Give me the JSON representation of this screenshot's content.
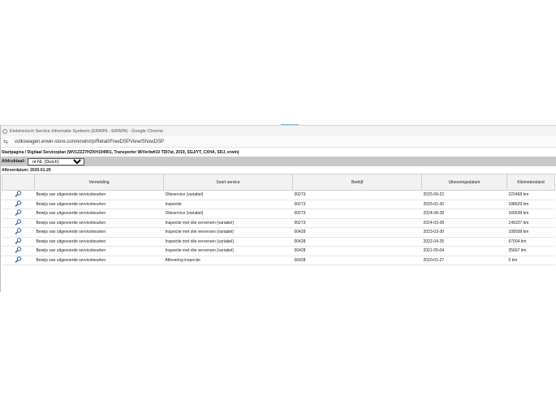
{
  "browser": {
    "title": "Elektronisch Service Informatie Systeem (ERWIN - ERWIN) - Google Chrome",
    "url": "volkswagen.erwin-store.com/erwin/rp/Retail/FreeDSPView/ShowDSP"
  },
  "breadcrumb": "Startpagina / Digitaal Serviceplan (WV1ZZZ7HZKH104901, Transporter W/Verlw#10 TDI7at, 2019, SGJ/YT, CXHA, SDJ, erwin)",
  "controls": {
    "label": "Afdruktaal:",
    "selected": "nl-NL (Dutch)"
  },
  "delivery_date": "Afleverdatum: 2020-01-29",
  "table": {
    "columns": [
      "",
      "Vermelding",
      "Soort service",
      "Bedrijf",
      "Uitvoeringsdatum",
      "Kilometerstand"
    ],
    "rows": [
      {
        "vermelding": "Bewijs van uitgevoerde servicebeurten",
        "soort": "Olieservice (variabel)",
        "bedrijf": "00273",
        "datum": "2025-09-22",
        "km": "222468 km"
      },
      {
        "vermelding": "Bewijs van uitgevoerde servicebeurten",
        "soort": "Inspectie",
        "bedrijf": "00273",
        "datum": "2025-01-30",
        "km": "188629 km"
      },
      {
        "vermelding": "Bewijs van uitgevoerde servicebeurten",
        "soort": "Olieservice (variabel)",
        "bedrijf": "00273",
        "datum": "2024-08-28",
        "km": "166638 km"
      },
      {
        "vermelding": "Bewijs van uitgevoerde servicebeurten",
        "soort": "Inspectie met olie verversen (variabel)",
        "bedrijf": "00273",
        "datum": "2024-03-28",
        "km": "149337 km"
      },
      {
        "vermelding": "Bewijs van uitgevoerde servicebeurten",
        "soort": "Inspectie met olie verversen (variabel)",
        "bedrijf": "00428",
        "datum": "2023-03-30",
        "km": "108938 km"
      },
      {
        "vermelding": "Bewijs van uitgevoerde servicebeurten",
        "soort": "Inspectie met olie verversen (variabel)",
        "bedrijf": "00428",
        "datum": "2022-04-25",
        "km": "67004 km"
      },
      {
        "vermelding": "Bewijs van uitgevoerde servicebeurten",
        "soort": "Inspectie met olie verversen (variabel)",
        "bedrijf": "00428",
        "datum": "2021-05-04",
        "km": "25667 km"
      },
      {
        "vermelding": "Bewijs van uitgevoerde servicebeurten",
        "soort": "Aflevering inspectie",
        "bedrijf": "00428",
        "datum": "2020-01-27",
        "km": "0 km"
      }
    ]
  }
}
